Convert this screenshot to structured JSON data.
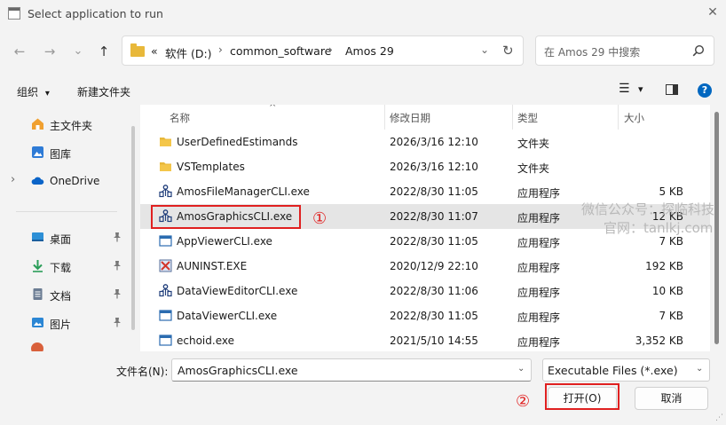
{
  "window": {
    "title": "Select application to run",
    "close_glyph": "✕"
  },
  "nav": {
    "back": "←",
    "forward": "→",
    "recent": "⌄",
    "up": "↑"
  },
  "address": {
    "more": "«",
    "crumbs": [
      "软件 (D:)",
      "common_software",
      "Amos 29"
    ],
    "sep": "›",
    "dropdown": "⌄",
    "refresh": "↻"
  },
  "search": {
    "placeholder": "在 Amos 29 中搜索"
  },
  "toolbar": {
    "organize": "组织",
    "organize_arrow": "▾",
    "new_folder": "新建文件夹",
    "view_glyph": "☰",
    "view_arrow": "▾",
    "help": "?"
  },
  "sidebar": {
    "items": [
      {
        "label": "主文件夹",
        "icon": "home-icon"
      },
      {
        "label": "图库",
        "icon": "gallery-icon"
      },
      {
        "label": "OneDrive",
        "icon": "cloud-icon",
        "expand": "›"
      },
      {
        "label": "桌面",
        "icon": "desktop-icon",
        "pin": "📌"
      },
      {
        "label": "下载",
        "icon": "download-icon",
        "pin": "📌"
      },
      {
        "label": "文档",
        "icon": "document-icon",
        "pin": "📌"
      },
      {
        "label": "图片",
        "icon": "picture-icon",
        "pin": "📌"
      }
    ]
  },
  "list": {
    "sort_arrow": "^",
    "headers": {
      "name": "名称",
      "date": "修改日期",
      "type": "类型",
      "size": "大小"
    },
    "rows": [
      {
        "name": "UserDefinedEstimands",
        "date": "2026/3/16 12:10",
        "type": "文件夹",
        "size": "",
        "icon": "folder-icon"
      },
      {
        "name": "VSTemplates",
        "date": "2026/3/16 12:10",
        "type": "文件夹",
        "size": "",
        "icon": "folder-icon"
      },
      {
        "name": "AmosFileManagerCLI.exe",
        "date": "2022/8/30 11:05",
        "type": "应用程序",
        "size": "5 KB",
        "icon": "amos-app-icon"
      },
      {
        "name": "AmosGraphicsCLI.exe",
        "date": "2022/8/30 11:07",
        "type": "应用程序",
        "size": "12 KB",
        "icon": "amos-app-icon",
        "selected": true
      },
      {
        "name": "AppViewerCLI.exe",
        "date": "2022/8/30 11:05",
        "type": "应用程序",
        "size": "7 KB",
        "icon": "window-app-icon"
      },
      {
        "name": "AUNINST.EXE",
        "date": "2020/12/9 22:10",
        "type": "应用程序",
        "size": "192 KB",
        "icon": "uninstall-icon"
      },
      {
        "name": "DataViewEditorCLI.exe",
        "date": "2022/8/30 11:06",
        "type": "应用程序",
        "size": "10 KB",
        "icon": "amos-app-icon"
      },
      {
        "name": "DataViewerCLI.exe",
        "date": "2022/8/30 11:05",
        "type": "应用程序",
        "size": "7 KB",
        "icon": "window-app-icon"
      },
      {
        "name": "echoid.exe",
        "date": "2021/5/10 14:55",
        "type": "应用程序",
        "size": "3,352 KB",
        "icon": "window-app-icon"
      }
    ]
  },
  "bottom": {
    "filename_label": "文件名(N):",
    "filename_value": "AmosGraphicsCLI.exe",
    "filter_value": "Executable Files (*.exe)",
    "chevron": "⌄",
    "open": "打开(O)",
    "cancel": "取消"
  },
  "annotations": {
    "one": "①",
    "two": "②"
  },
  "watermark": {
    "line1": "微信公众号：探临科技",
    "line2": "官网：tanlkj.com"
  },
  "colors": {
    "folder": "#e8b83a",
    "accent": "#0067c0",
    "annotation_red": "#e02020"
  }
}
